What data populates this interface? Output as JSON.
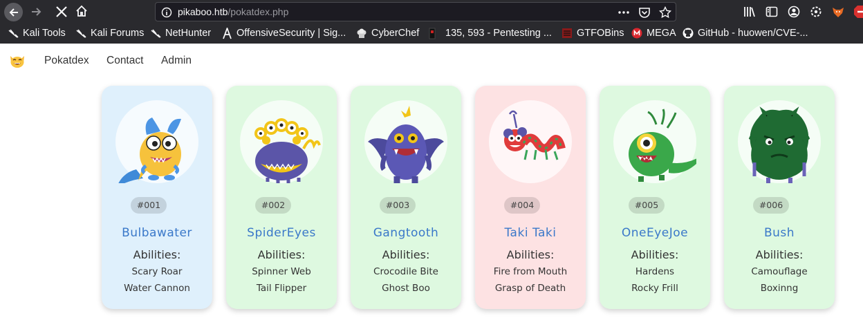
{
  "browser": {
    "url_host": "pikaboo.htb",
    "url_path": "/pokatdex.php",
    "bookmarks": [
      "Kali Tools",
      "Kali Forums",
      "NetHunter",
      "OffensiveSecurity | Sig...",
      "CyberChef",
      "135, 593 - Pentesting ...",
      "GTFOBins",
      "MEGA",
      "GitHub - huowen/CVE-..."
    ]
  },
  "site_nav": {
    "links": [
      "Pokatdex",
      "Contact",
      "Admin"
    ]
  },
  "cards": [
    {
      "id": "#001",
      "name": "Bulbawater",
      "abilities_label": "Abilities:",
      "abilities": [
        "Scary Roar",
        "Water Cannon"
      ],
      "bg": "#dff0fc"
    },
    {
      "id": "#002",
      "name": "SpiderEyes",
      "abilities_label": "Abilities:",
      "abilities": [
        "Spinner Web",
        "Tail Flipper"
      ],
      "bg": "#def9e0"
    },
    {
      "id": "#003",
      "name": "Gangtooth",
      "abilities_label": "Abilities:",
      "abilities": [
        "Crocodile Bite",
        "Ghost Boo"
      ],
      "bg": "#def9e0"
    },
    {
      "id": "#004",
      "name": "Taki Taki",
      "abilities_label": "Abilities:",
      "abilities": [
        "Fire from Mouth",
        "Grasp of Death"
      ],
      "bg": "#fde2e3"
    },
    {
      "id": "#005",
      "name": "OneEyeJoe",
      "abilities_label": "Abilities:",
      "abilities": [
        "Hardens",
        "Rocky Frill"
      ],
      "bg": "#def9e0"
    },
    {
      "id": "#006",
      "name": "Bush",
      "abilities_label": "Abilities:",
      "abilities": [
        "Camouflage",
        "Boxinng"
      ],
      "bg": "#def9e0"
    }
  ]
}
